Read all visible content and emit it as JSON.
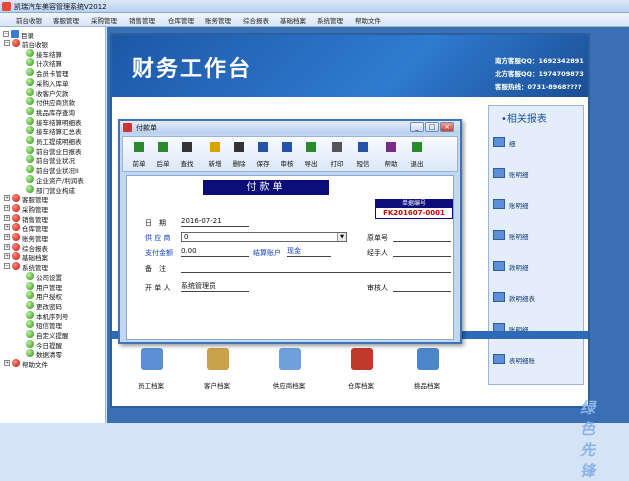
{
  "window": {
    "title": "凯瑞汽车美容管理系统V2012"
  },
  "menu": [
    "前台收银",
    "客服管理",
    "采购管理",
    "销售管理",
    "仓库管理",
    "账务管理",
    "综合报表",
    "基础档案",
    "系统管理",
    "帮助文件"
  ],
  "sidebar": {
    "root": "目录",
    "items": [
      {
        "label": "前台收银",
        "level": 1,
        "icon": "red"
      },
      {
        "label": "接车结算",
        "level": 2,
        "icon": "green"
      },
      {
        "label": "计次结算",
        "level": 2,
        "icon": "green"
      },
      {
        "label": "会员卡管理",
        "level": 2,
        "icon": "green"
      },
      {
        "label": "采购入库单",
        "level": 2,
        "icon": "green"
      },
      {
        "label": "收客户欠款",
        "level": 2,
        "icon": "green"
      },
      {
        "label": "付供应商货款",
        "level": 2,
        "icon": "green"
      },
      {
        "label": "挑品库存查询",
        "level": 2,
        "icon": "green"
      },
      {
        "label": "接车结算明细表",
        "level": 2,
        "icon": "green"
      },
      {
        "label": "接车结算汇总表",
        "level": 2,
        "icon": "green"
      },
      {
        "label": "员工提成明细表",
        "level": 2,
        "icon": "green"
      },
      {
        "label": "前台营业日报表",
        "level": 2,
        "icon": "green"
      },
      {
        "label": "前台营业状况",
        "level": 2,
        "icon": "green"
      },
      {
        "label": "前台营业状况II",
        "level": 2,
        "icon": "green"
      },
      {
        "label": "企业资产/利润表",
        "level": 2,
        "icon": "green"
      },
      {
        "label": "部门营业构成",
        "level": 2,
        "icon": "green"
      },
      {
        "label": "客服管理",
        "level": 1,
        "icon": "red"
      },
      {
        "label": "采购管理",
        "level": 1,
        "icon": "red"
      },
      {
        "label": "销售管理",
        "level": 1,
        "icon": "red"
      },
      {
        "label": "仓库管理",
        "level": 1,
        "icon": "red"
      },
      {
        "label": "账务管理",
        "level": 1,
        "icon": "red"
      },
      {
        "label": "综合报表",
        "level": 1,
        "icon": "red"
      },
      {
        "label": "基础档案",
        "level": 1,
        "icon": "red"
      },
      {
        "label": "系统管理",
        "level": 1,
        "icon": "red"
      },
      {
        "label": "公司设置",
        "level": 2,
        "icon": "green"
      },
      {
        "label": "用户管理",
        "level": 2,
        "icon": "green"
      },
      {
        "label": "用户授权",
        "level": 2,
        "icon": "green"
      },
      {
        "label": "更改密码",
        "level": 2,
        "icon": "green"
      },
      {
        "label": "本机序列号",
        "level": 2,
        "icon": "green"
      },
      {
        "label": "短信管理",
        "level": 2,
        "icon": "green"
      },
      {
        "label": "自定义提醒",
        "level": 2,
        "icon": "green"
      },
      {
        "label": "今日提醒",
        "level": 2,
        "icon": "green"
      },
      {
        "label": "数据清零",
        "level": 2,
        "icon": "green"
      },
      {
        "label": "帮助文件",
        "level": 1,
        "icon": "red"
      }
    ]
  },
  "workbench": {
    "banner_title": "财务工作台",
    "contacts": [
      "南方客服QQ：1692342891",
      "北方客服QQ：1974709873",
      "客服热线：0731-8968????"
    ],
    "right_title": "•相关报表",
    "right_items": [
      "细",
      "账明细",
      "账明细",
      "账明细",
      "款明细",
      "款明细表",
      "账明细",
      "表明细账"
    ],
    "bottom_icons": [
      {
        "label": "员工档案",
        "color": "#5b8fd6"
      },
      {
        "label": "客户档案",
        "color": "#c9a24a"
      },
      {
        "label": "供应商档案",
        "color": "#6fa0dc"
      },
      {
        "label": "仓库档案",
        "color": "#c0392b"
      },
      {
        "label": "挑品档案",
        "color": "#4a86c8"
      }
    ],
    "watermark": "绿色先锋"
  },
  "dialog": {
    "title": "付款单",
    "toolbar": [
      {
        "label": "前单",
        "icon": "prev-icon",
        "color": "#2b8a2b"
      },
      {
        "label": "后单",
        "icon": "next-icon",
        "color": "#2b8a2b"
      },
      {
        "label": "查找",
        "icon": "binoculars-icon",
        "color": "#333"
      },
      {
        "label": "新增",
        "icon": "new-icon",
        "color": "#d9a400"
      },
      {
        "label": "删除",
        "icon": "delete-icon",
        "color": "#333"
      },
      {
        "label": "保存",
        "icon": "save-icon",
        "color": "#2255aa"
      },
      {
        "label": "审核",
        "icon": "audit-icon",
        "color": "#2255aa"
      },
      {
        "label": "导出",
        "icon": "export-icon",
        "color": "#2b8a2b"
      },
      {
        "label": "打印",
        "icon": "print-icon",
        "color": "#555"
      },
      {
        "label": "短信",
        "icon": "sms-icon",
        "color": "#2255aa"
      },
      {
        "label": "帮助",
        "icon": "help-icon",
        "color": "#7a2b8a"
      },
      {
        "label": "退出",
        "icon": "exit-icon",
        "color": "#2b8a2b"
      }
    ],
    "form": {
      "title": "付款单",
      "doc_no_label": "单据编号",
      "doc_no": "FK201607-0001",
      "date_label": "日　期",
      "date": "2016-07-21",
      "supplier_label": "供 应 商",
      "supplier": "0",
      "orig_no_label": "原单号",
      "amount_label": "支付金额",
      "amount": "0.00",
      "account_label": "结算账户",
      "account": "现金",
      "handler_label": "经手人",
      "remark_label": "备　注",
      "maker_label": "开 单 人",
      "maker": "系统管理员",
      "auditor_label": "审核人"
    }
  }
}
